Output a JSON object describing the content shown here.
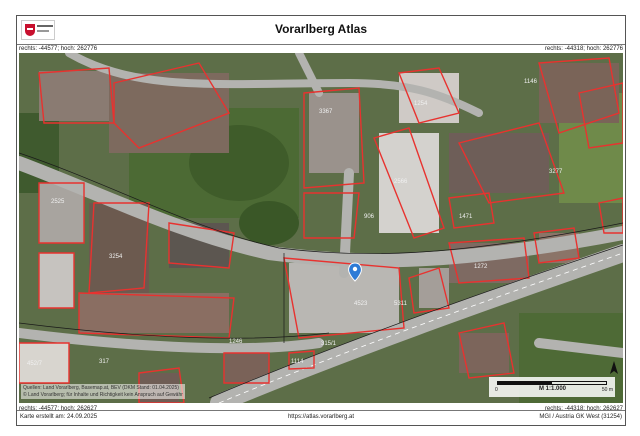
{
  "header": {
    "title": "Vorarlberg Atlas"
  },
  "coords": {
    "top_left": "rechts: -44577; hoch: 262776",
    "top_right": "rechts: -44318; hoch: 262776",
    "bottom_left": "rechts: -44577; hoch: 262627",
    "bottom_right": "rechts: -44318; hoch: 262627"
  },
  "attribution": {
    "line1": "Quellen: Land Vorarlberg, Basemap.at, BEV (DKM Stand: 01.04.2025)",
    "line2": "© Land Vorarlberg; für Inhalte und Richtigkeit kein Anspruch auf Gewähr"
  },
  "scale": {
    "ratio": "M 1:1.000",
    "start": "0",
    "end": "50 m"
  },
  "parcels": {
    "p1": "1254",
    "p2": "1146",
    "p3": "3277",
    "p4": "2525",
    "p5": "3254",
    "p6": "4523",
    "p7": "5311",
    "p8": "315/1",
    "p9": "1114",
    "p10": "452/7",
    "p11": "317",
    "p12": "1246",
    "p13": "1471",
    "p14": "3367",
    "p15": "2566",
    "p16": "906",
    "p17": "1272"
  },
  "footer": {
    "created": "Karte erstellt am: 24.09.2025",
    "url": "https://atlas.vorarlberg.at",
    "crs": "MGI / Austria GK West (31254)"
  },
  "colors": {
    "parcel": "#e8322f",
    "road": "#b3b3b0",
    "marker": "#2e7bd6",
    "vegetation": "#50683a"
  }
}
